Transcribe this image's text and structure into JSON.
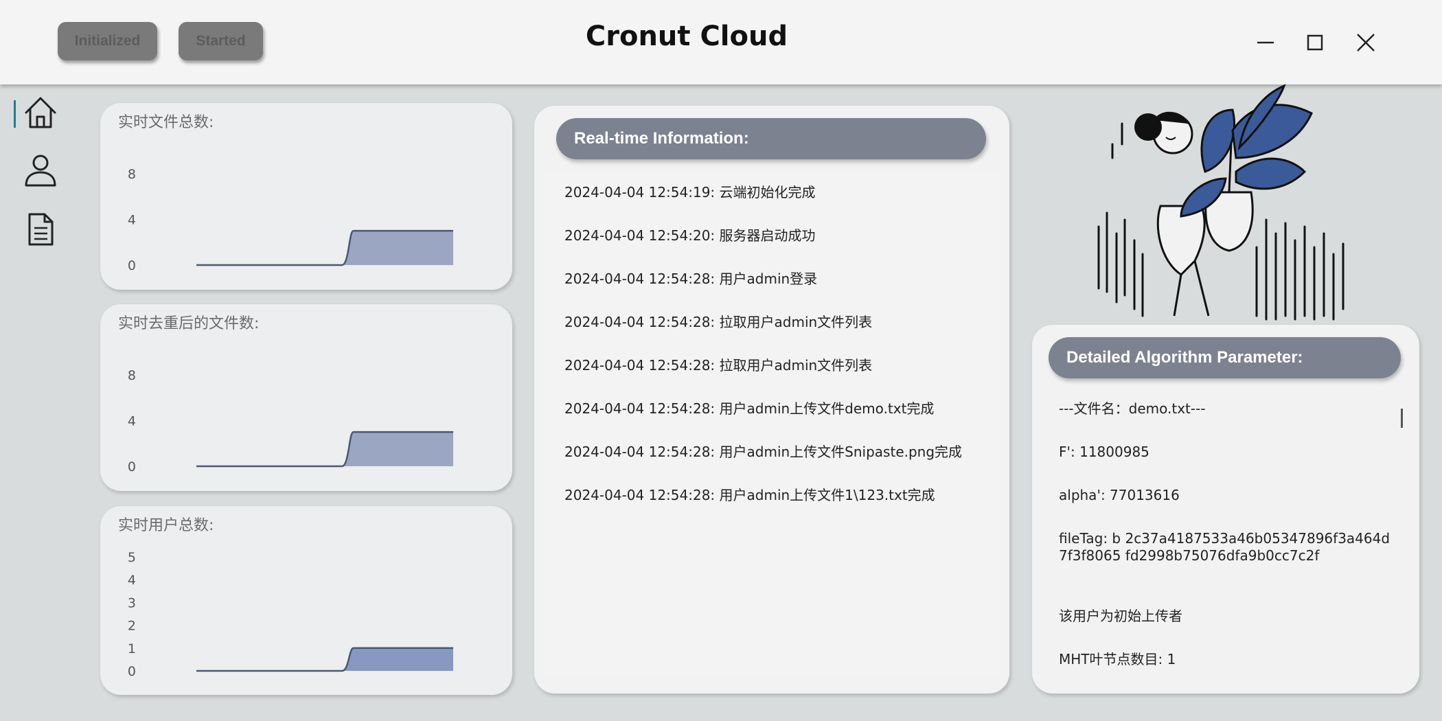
{
  "titlebar": {
    "status_buttons": [
      "Initialized",
      "Started"
    ],
    "app_title": "Cronut Cloud"
  },
  "nav": {
    "items": [
      "home-icon",
      "user-icon",
      "document-icon"
    ],
    "active": "home-icon"
  },
  "charts": {
    "files_total": {
      "title": "实时文件总数:"
    },
    "files_dedup": {
      "title": "实时去重后的文件数:"
    },
    "users_total": {
      "title": "实时用户总数:"
    }
  },
  "chart_data": [
    {
      "type": "area",
      "title": "实时文件总数:",
      "yticks": [
        "0",
        "4",
        "8"
      ],
      "ylim": [
        0,
        8
      ],
      "x": [
        0,
        1,
        2,
        3,
        4,
        5,
        6,
        7,
        8,
        9
      ],
      "values": [
        0,
        0,
        0,
        0,
        0,
        0,
        3,
        3,
        3,
        3
      ],
      "color": "#9aa6c2"
    },
    {
      "type": "area",
      "title": "实时去重后的文件数:",
      "yticks": [
        "0",
        "4",
        "8"
      ],
      "ylim": [
        0,
        8
      ],
      "x": [
        0,
        1,
        2,
        3,
        4,
        5,
        6,
        7,
        8,
        9
      ],
      "values": [
        0,
        0,
        0,
        0,
        0,
        0,
        3,
        3,
        3,
        3
      ],
      "color": "#9aa6c2"
    },
    {
      "type": "area",
      "title": "实时用户总数:",
      "yticks": [
        "0",
        "1",
        "2",
        "3",
        "4",
        "5"
      ],
      "ylim": [
        0,
        5
      ],
      "x": [
        0,
        1,
        2,
        3,
        4,
        5,
        6,
        7,
        8,
        9
      ],
      "values": [
        0,
        0,
        0,
        0,
        0,
        0,
        1,
        1,
        1,
        1
      ],
      "color": "#8799c0"
    }
  ],
  "realtime": {
    "header": "Real-time Information:",
    "logs": [
      "2024-04-04 12:54:19:  云端初始化完成",
      "2024-04-04 12:54:20:  服务器启动成功",
      "2024-04-04 12:54:28:  用户admin登录",
      "2024-04-04 12:54:28:  拉取用户admin文件列表",
      "2024-04-04 12:54:28:  拉取用户admin文件列表",
      "2024-04-04 12:54:28:  用户admin上传文件demo.txt完成",
      "2024-04-04 12:54:28:  用户admin上传文件Snipaste.png完成",
      "2024-04-04 12:54:28:  用户admin上传文件1\\123.txt完成"
    ]
  },
  "params": {
    "header": "Detailed Algorithm Parameter:",
    "lines": [
      "---文件名：demo.txt---",
      "F': 11800985",
      "alpha': 77013616",
      "fileTag: b 2c37a4187533a46b05347896f3a464d7f3f8065 fd2998b75076dfa9b0cc7c2f",
      "该用户为初始上传者",
      "MHT叶节点数目: 1"
    ]
  },
  "colors": {
    "accent": "#1f7f8e",
    "header_pill": "#7d8290",
    "chart_fill": "#9aa6c2",
    "plant_blue": "#3b5a99"
  }
}
